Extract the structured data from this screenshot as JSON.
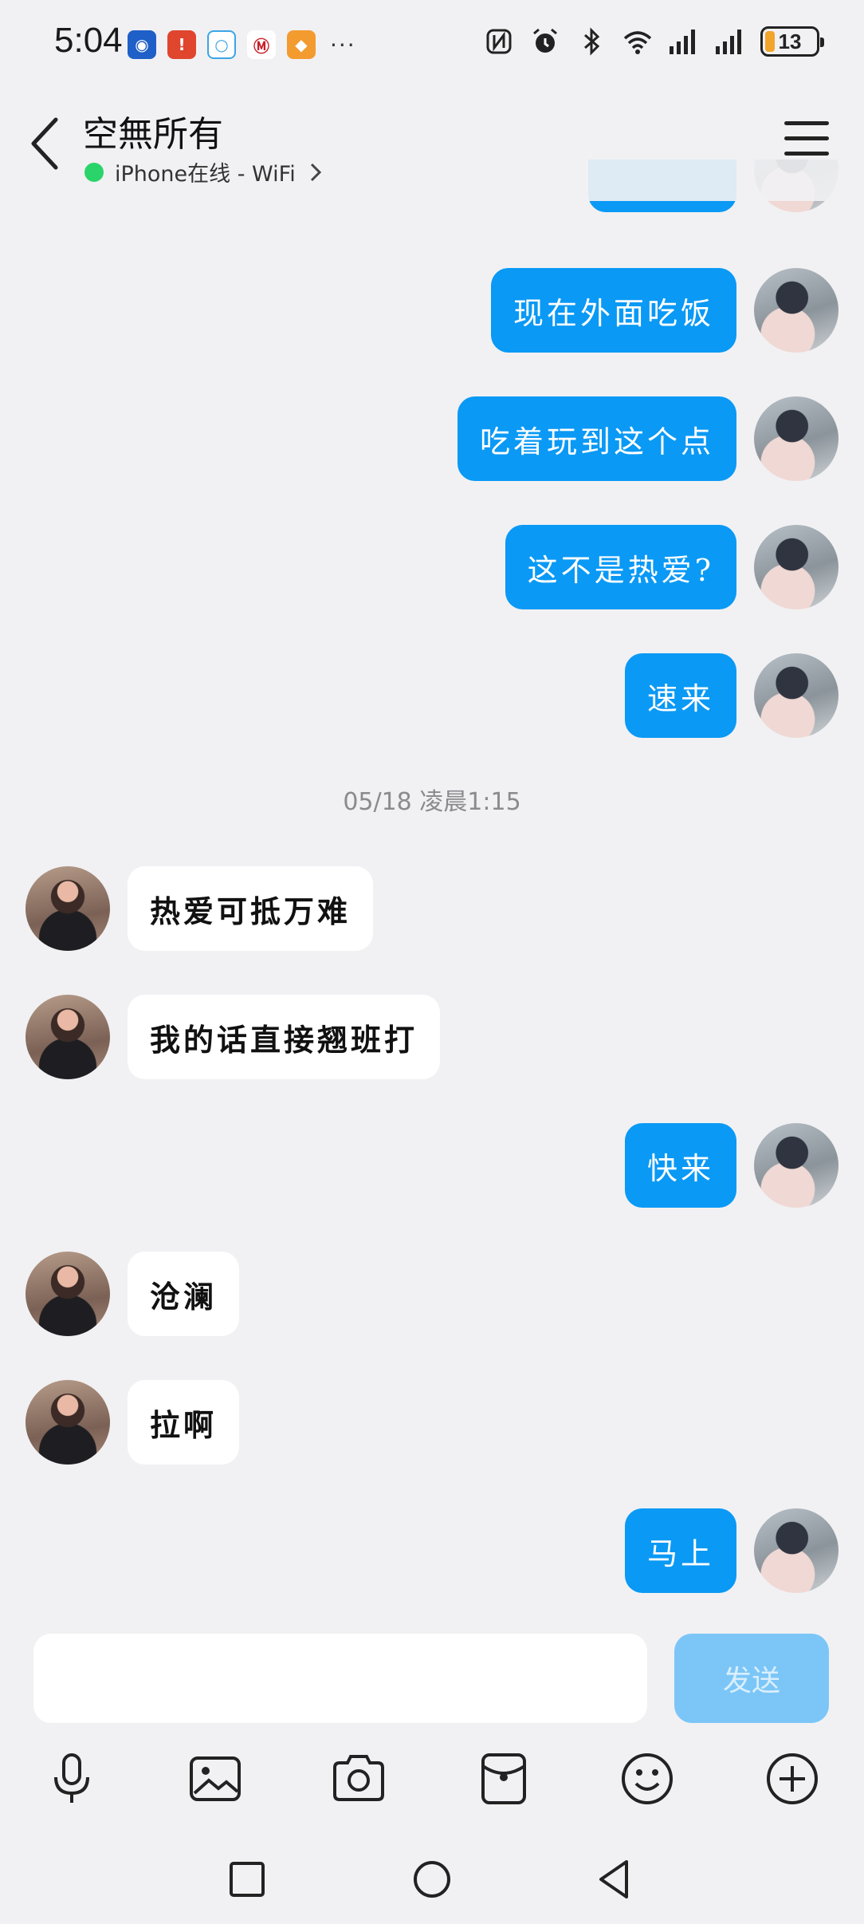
{
  "status_bar": {
    "time": "5:04",
    "battery": "13",
    "more_indicator": "···",
    "app_icons": [
      "payment-app-icon",
      "red-app-icon",
      "chat-bubble-app-icon",
      "bank-app-icon",
      "shopping-app-icon"
    ],
    "system_icons": [
      "nfc-icon",
      "alarm-icon",
      "bluetooth-icon",
      "wifi-icon",
      "signal-icon",
      "signal-icon"
    ]
  },
  "header": {
    "title": "空無所有",
    "status": "iPhone在线 - WiFi",
    "status_color": "#2bd46a"
  },
  "timestamp": "05/18 凌晨1:15",
  "messages": [
    {
      "side": "me",
      "text": "现在外面吃饭"
    },
    {
      "side": "me",
      "text": "吃着玩到这个点"
    },
    {
      "side": "me",
      "text": "这不是热爱?"
    },
    {
      "side": "me",
      "text": "速来"
    },
    {
      "side": "her",
      "text": "热爱可抵万难"
    },
    {
      "side": "her",
      "text": "我的话直接翘班打"
    },
    {
      "side": "me",
      "text": "快来"
    },
    {
      "side": "her",
      "text": "沧澜"
    },
    {
      "side": "her",
      "text": "拉啊"
    },
    {
      "side": "me",
      "text": "马上"
    }
  ],
  "input": {
    "value": "",
    "send_label": "发送"
  },
  "toolbar": [
    "microphone-icon",
    "image-icon",
    "camera-icon",
    "red-packet-icon",
    "emoji-icon",
    "plus-icon"
  ],
  "colors": {
    "my_bubble": "#0a99f5",
    "their_bubble": "#ffffff",
    "background": "#f1f1f3",
    "send_button": "#7cc6f7"
  }
}
